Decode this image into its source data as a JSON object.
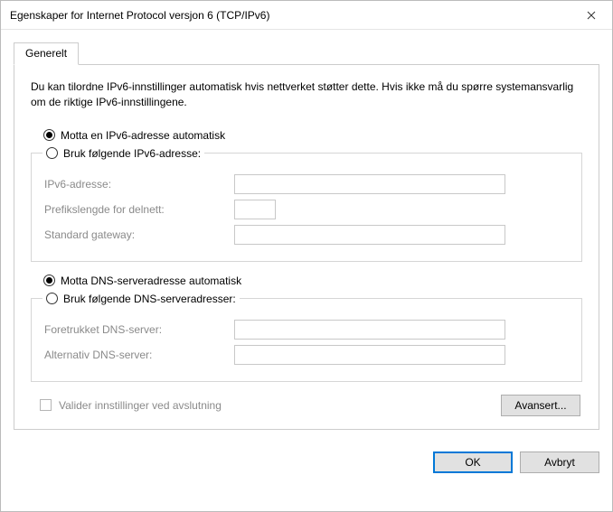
{
  "window": {
    "title": "Egenskaper for Internet Protocol versjon 6 (TCP/IPv6)"
  },
  "tab": {
    "general": "Generelt"
  },
  "description": "Du kan tilordne IPv6-innstillinger automatisk hvis nettverket støtter dette. Hvis ikke må du spørre systemansvarlig om de riktige IPv6-innstillingene.",
  "ip": {
    "auto_label": "Motta en IPv6-adresse automatisk",
    "manual_label": "Bruk følgende IPv6-adresse:",
    "address_label": "IPv6-adresse:",
    "address_value": "",
    "prefix_label": "Prefikslengde for delnett:",
    "prefix_value": "",
    "gateway_label": "Standard gateway:",
    "gateway_value": ""
  },
  "dns": {
    "auto_label": "Motta DNS-serveradresse automatisk",
    "manual_label": "Bruk følgende DNS-serveradresser:",
    "preferred_label": "Foretrukket DNS-server:",
    "preferred_value": "",
    "alternate_label": "Alternativ DNS-server:",
    "alternate_value": ""
  },
  "validate_label": "Valider innstillinger ved avslutning",
  "buttons": {
    "advanced": "Avansert...",
    "ok": "OK",
    "cancel": "Avbryt"
  }
}
